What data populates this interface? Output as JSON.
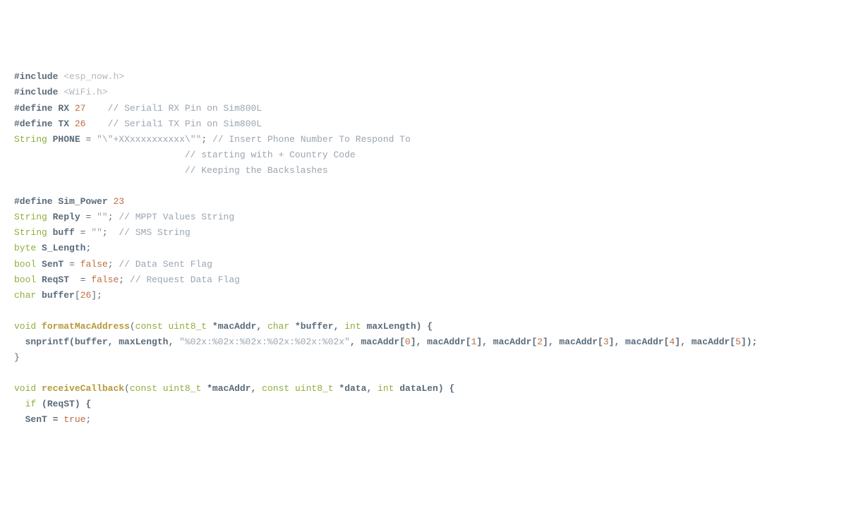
{
  "code": {
    "l1": {
      "a": "#include",
      "b": "<esp_now.h>"
    },
    "l2": {
      "a": "#include",
      "b": "<WiFi.h>"
    },
    "l3": {
      "a": "#define",
      "b": "RX",
      "c": "27",
      "d": "// Serial1 RX Pin on Sim800L"
    },
    "l4": {
      "a": "#define",
      "b": "TX",
      "c": "26",
      "d": "// Serial1 TX Pin on Sim800L"
    },
    "l5": {
      "a": "String",
      "b": "PHONE",
      "c": "=",
      "d": "\"\\\"+XXxxxxxxxxxx\\\"\"",
      "e": ";",
      "f": "// Insert Phone Number To Respond To"
    },
    "l6": {
      "a": "// starting with + Country Code"
    },
    "l7": {
      "a": "// Keeping the Backslashes"
    },
    "l8": {
      "a": "#define",
      "b": "Sim_Power",
      "c": "23"
    },
    "l9": {
      "a": "String",
      "b": "Reply",
      "c": "=",
      "d": "\"\"",
      "e": ";",
      "f": "// MPPT Values String"
    },
    "l10": {
      "a": "String",
      "b": "buff",
      "c": "=",
      "d": "\"\"",
      "e": ";",
      "f": "// SMS String"
    },
    "l11": {
      "a": "byte",
      "b": "S_Length",
      "c": ";"
    },
    "l12": {
      "a": "bool",
      "b": "SenT",
      "c": "=",
      "d": "false",
      "e": ";",
      "f": "// Data Sent Flag"
    },
    "l13": {
      "a": "bool",
      "b": "ReqST",
      "c": "=",
      "d": "false",
      "e": ";",
      "f": "// Request Data Flag"
    },
    "l14": {
      "a": "char",
      "b": "buffer",
      "c": "[",
      "d": "26",
      "e": "];"
    },
    "l15": {
      "a": "void",
      "b": "formatMacAddress",
      "c": "(",
      "d": "const",
      "e": "uint8_t",
      "f": "*macAddr,",
      "g": "char",
      "h": "*buffer,",
      "i": "int",
      "j": "maxLength) {"
    },
    "l16": {
      "a": "snprintf(buffer, maxLength,",
      "b": "\"%02x:%02x:%02x:%02x:%02x:%02x\"",
      "c": ", macAddr[",
      "d": "0",
      "e": "], macAddr[",
      "f": "1",
      "g": "], macAddr[",
      "h": "2",
      "i": "], macAddr[",
      "j": "3",
      "k": "], macAddr[",
      "l": "4",
      "m": "], macAddr[",
      "n": "5",
      "o": "]);"
    },
    "l17": {
      "a": "}"
    },
    "l18": {
      "a": "void",
      "b": "receiveCallback",
      "c": "(",
      "d": "const",
      "e": "uint8_t",
      "f": "*macAddr,",
      "g": "const",
      "h": "uint8_t",
      "i": "*data,",
      "j": "int",
      "k": "dataLen) {"
    },
    "l19": {
      "a": "if",
      "b": "(ReqST) {"
    },
    "l20": {
      "a": "SenT =",
      "b": "true",
      "c": ";"
    }
  }
}
